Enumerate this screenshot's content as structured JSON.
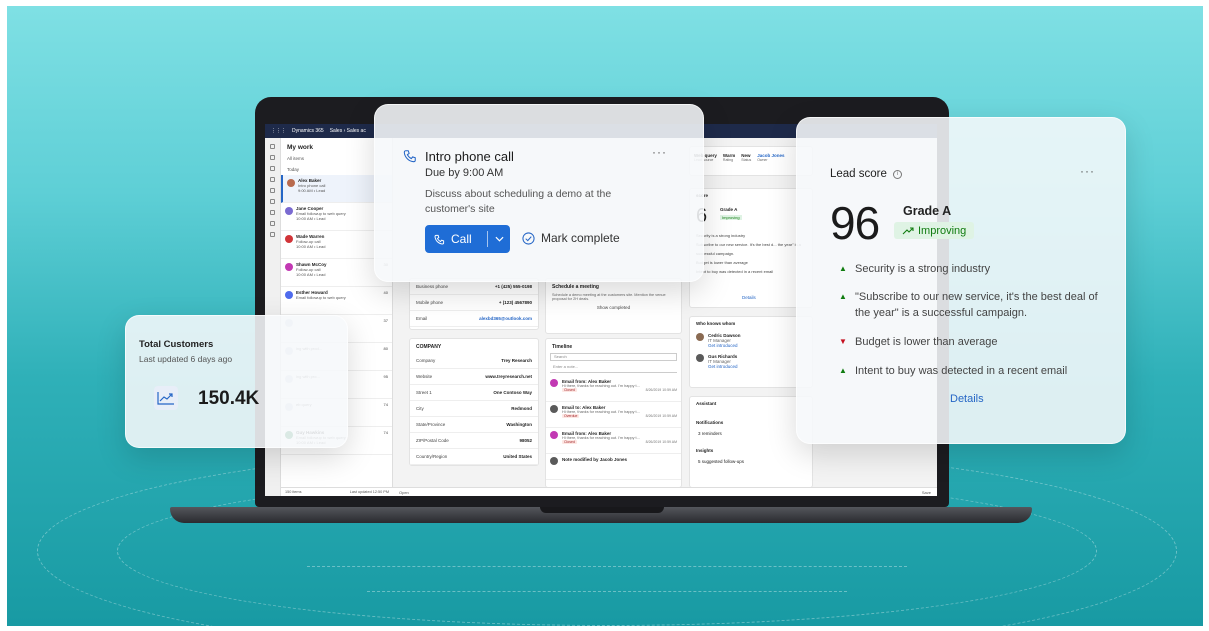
{
  "app": {
    "name": "Dynamics 365",
    "breadcrumb": [
      "Sales",
      "Sales ac"
    ]
  },
  "worklist": {
    "title": "My work",
    "filter": "All items",
    "section": "Today",
    "items": [
      {
        "name": "Alex Baker",
        "sub": "Intro phone call",
        "time": "9:00 AM • Lead",
        "avatar_color": "#b86a4e"
      },
      {
        "name": "Jane Cooper",
        "sub": "Email followup to web query",
        "time": "10:00 AM • Lead",
        "avatar_color": "#7a6ad1"
      },
      {
        "name": "Wade Warren",
        "sub": "Follow-up call",
        "time": "10:00 AM • Lead",
        "avatar_color": "#d13438"
      },
      {
        "name": "Shawn McCoy",
        "sub": "Follow-up call",
        "time": "10:00 AM • Lead",
        "avatar_color": "#c239b3",
        "count": "30"
      },
      {
        "name": "Esther Howard",
        "sub": "Email followup to web query",
        "time": "",
        "avatar_color": "#4f6bed",
        "count": "40"
      },
      {
        "name": "",
        "sub": "",
        "time": "",
        "avatar_color": "#cfd6e0",
        "count": "37"
      },
      {
        "name": "",
        "sub": "ing with prod...",
        "time": "",
        "avatar_color": "#cfd6e0",
        "count": "80"
      },
      {
        "name": "",
        "sub": "ing with pro...",
        "time": "",
        "avatar_color": "#cfd6e0",
        "count": "95"
      },
      {
        "name": "",
        "sub": "eb query",
        "time": "",
        "avatar_color": "#cfd6e0",
        "count": "74"
      },
      {
        "name": "Guy Hawkins",
        "sub": "Email followup to web query",
        "time": "10:00 AM • Lead",
        "avatar_color": "#107c41",
        "count": "74"
      }
    ],
    "footer_count": "150 items",
    "footer_updated": "Last updated 12:50 PM"
  },
  "contact_card": {
    "rows": [
      {
        "k": "Business phone",
        "v": "+1 (425) 555-0198"
      },
      {
        "k": "Mobile phone",
        "v": "+ (123) 4567890"
      },
      {
        "k": "Email",
        "v": "alexbd365@outlook.com"
      }
    ]
  },
  "company_card": {
    "title": "COMPANY",
    "rows": [
      {
        "k": "Company",
        "v": "Trey Research"
      },
      {
        "k": "Website",
        "v": "www.treyresearch.net"
      },
      {
        "k": "Street 1",
        "v": "One Contoso Way"
      },
      {
        "k": "City",
        "v": "Redmond"
      },
      {
        "k": "State/Province",
        "v": "Washington"
      },
      {
        "k": "ZIP/Postal Code",
        "v": "98052"
      },
      {
        "k": "Country/Region",
        "v": "United States"
      }
    ]
  },
  "meeting": {
    "title": "Schedule a meeting",
    "desc": "Schedule a demo meeting at the customers site. Mention the venue proposal for 2H deals.",
    "show_completed": "Show completed"
  },
  "timeline": {
    "title": "Timeline",
    "search": "Search",
    "note": "Enter a note...",
    "items": [
      {
        "title": "Email from: Alex Baker",
        "body": "Hi there, thanks for reaching out. I'm happy t...",
        "tag": "Closed",
        "date": "8/26/2019 10:59 AM"
      },
      {
        "title": "Email to: Alex Baker",
        "body": "Hi there, thanks for reaching out. I'm happy t...",
        "tag": "Overdue",
        "date": "8/26/2019 10:59 AM"
      },
      {
        "title": "Email from: Alex Baker",
        "body": "Hi there, thanks for reaching out. I'm happy t...",
        "tag": "Closed",
        "date": "8/26/2019 10:59 AM"
      },
      {
        "title": "Note modified by Jacob Jones",
        "body": "",
        "tag": "",
        "date": ""
      }
    ]
  },
  "header_fields": [
    {
      "label": "Web query",
      "value": "Lead source"
    },
    {
      "label": "Warm",
      "value": "Rating"
    },
    {
      "label": "New",
      "value": "Status"
    },
    {
      "label": "Jacob Jones",
      "value": "Owner"
    }
  ],
  "mini_lead": {
    "title": "score",
    "score": "6",
    "grade": "Grade A",
    "trend": "Improving",
    "lines": [
      "Security is a strong industry",
      "Subscribe to our new service. It's the best d... the year\" is a successful campaign.",
      "Budget is lower than average",
      "Intent to buy was detected in a recent email"
    ],
    "details": "Details"
  },
  "who_knows": {
    "title": "Who knows whom",
    "people": [
      {
        "name": "Cedric Dawson",
        "role": "IT Manager",
        "link": "Get introduced"
      },
      {
        "name": "Gus Richards",
        "role": "IT Manager",
        "link": "Get introduced"
      }
    ]
  },
  "assistant": {
    "title": "Assistant",
    "notifications": "Notifications",
    "reminders": "3 reminders",
    "insights": "Insights",
    "followups": "5 suggested follow-ups"
  },
  "bottom_bar": {
    "open": "Open",
    "save": "Save"
  },
  "call_card": {
    "title": "Intro phone call",
    "due": "Due by 9:00 AM",
    "description": "Discuss about scheduling a demo at the customer's site",
    "call_label": "Call",
    "mark_complete": "Mark complete",
    "more": "···"
  },
  "lead_card": {
    "title": "Lead score",
    "score": "96",
    "grade": "Grade A",
    "trend": "Improving",
    "insights": [
      {
        "text": "Security is a strong industry",
        "direction": "up"
      },
      {
        "text": "\"Subscribe to our new service, it's the best deal of the year\" is a successful campaign.",
        "direction": "up"
      },
      {
        "text": "Budget is lower than average",
        "direction": "down"
      },
      {
        "text": "Intent to buy was detected in a recent email",
        "direction": "up"
      }
    ],
    "details": "Details",
    "more": "···",
    "colors": {
      "up": "#107c10",
      "down": "#c50f1f"
    }
  },
  "customers_card": {
    "title": "Total Customers",
    "subtitle": "Last updated 6 days ago",
    "value": "150.4K",
    "icon": "trend-up-icon"
  }
}
